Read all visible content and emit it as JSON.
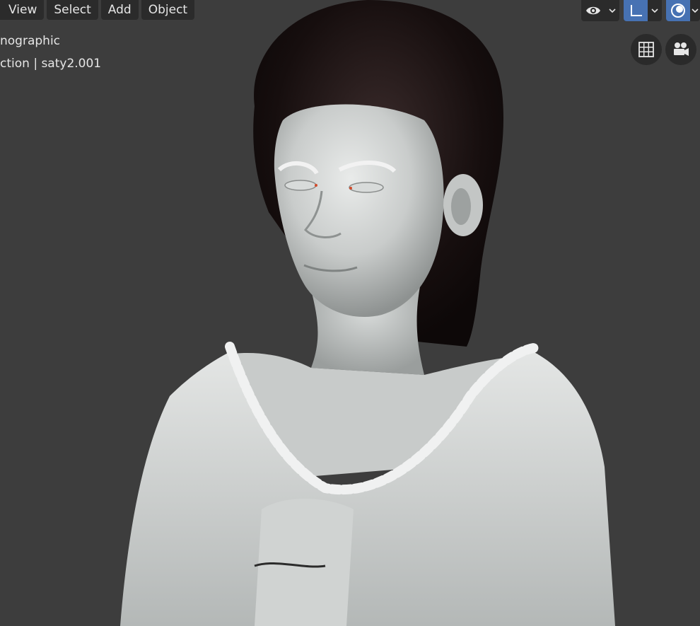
{
  "header": {
    "menu": [
      {
        "label": "View"
      },
      {
        "label": "Select"
      },
      {
        "label": "Add"
      },
      {
        "label": "Object"
      }
    ],
    "tools": {
      "visibility_icon": "eye-icon",
      "gizmo_icon": "axis-gizmo-icon",
      "overlay_icon": "overlays-icon"
    }
  },
  "viewport": {
    "view_mode": "nographic",
    "collection_line": "ction | saty2.001",
    "nav_buttons": [
      {
        "icon": "grid-icon"
      },
      {
        "icon": "camera-icon"
      }
    ],
    "accent_color": "#4772b3",
    "background_color": "#3d3d3d"
  }
}
